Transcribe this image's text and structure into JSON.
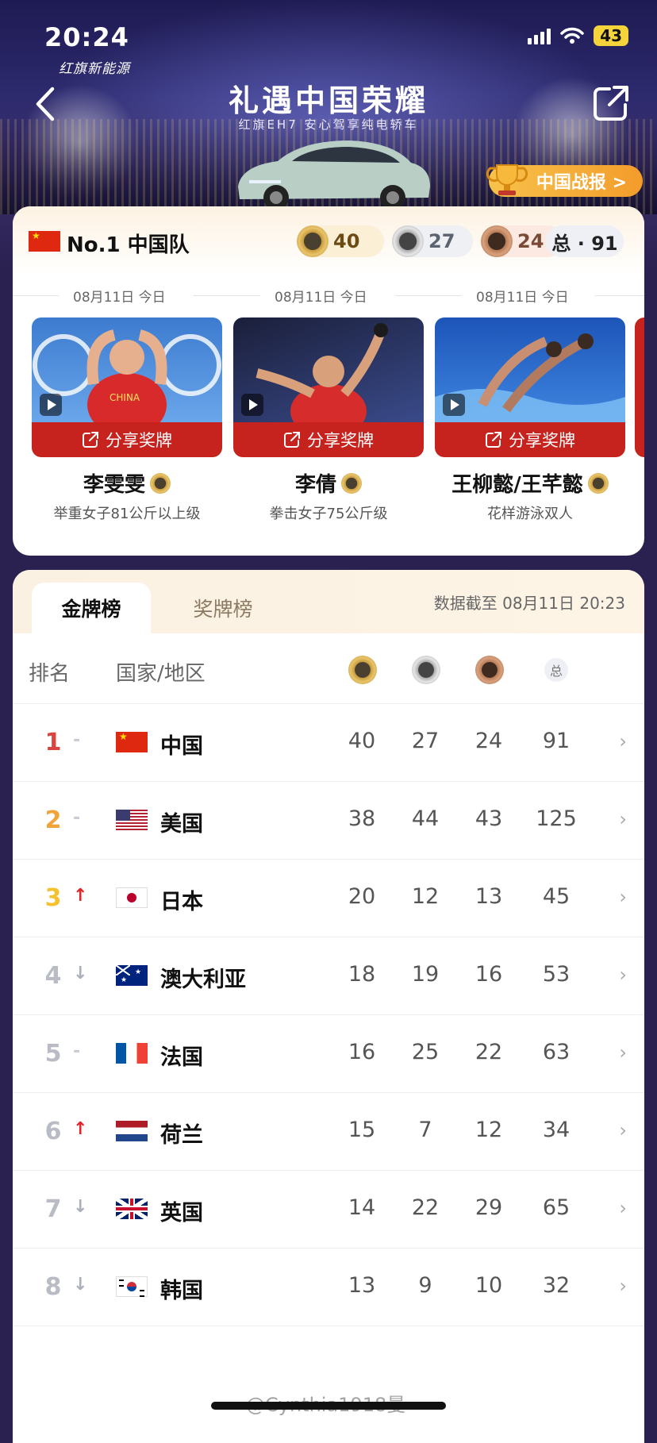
{
  "status_bar": {
    "time": "20:24",
    "battery": "43"
  },
  "hero": {
    "brand": "红旗新能源",
    "title": "礼遇中国荣耀",
    "subtitle": "红旗EH7  安心驾享纯电轿车",
    "report_button": "中国战报 >"
  },
  "team": {
    "name": "No.1 中国队",
    "gold": "40",
    "silver": "27",
    "bronze": "24",
    "total": "总 · 91"
  },
  "share_label": "分享奖牌",
  "athletes": [
    {
      "date": "08月11日 今日",
      "name": "李雯雯",
      "event": "举重女子81公斤以上级"
    },
    {
      "date": "08月11日 今日",
      "name": "李倩",
      "event": "拳击女子75公斤级"
    },
    {
      "date": "08月11日 今日",
      "name": "王柳懿/王芊懿",
      "event": "花样游泳双人"
    }
  ],
  "ranking": {
    "tab_gold": "金牌榜",
    "tab_medal": "奖牌榜",
    "updated": "数据截至 08月11日 20:23",
    "col_rank": "排名",
    "col_country": "国家/地区",
    "col_total": "总",
    "rows": [
      {
        "rank": "1",
        "trend": "-",
        "country": "中国",
        "gold": "40",
        "silver": "27",
        "bronze": "24",
        "total": "91"
      },
      {
        "rank": "2",
        "trend": "-",
        "country": "美国",
        "gold": "38",
        "silver": "44",
        "bronze": "43",
        "total": "125"
      },
      {
        "rank": "3",
        "trend": "↑",
        "country": "日本",
        "gold": "20",
        "silver": "12",
        "bronze": "13",
        "total": "45"
      },
      {
        "rank": "4",
        "trend": "↓",
        "country": "澳大利亚",
        "gold": "18",
        "silver": "19",
        "bronze": "16",
        "total": "53"
      },
      {
        "rank": "5",
        "trend": "-",
        "country": "法国",
        "gold": "16",
        "silver": "25",
        "bronze": "22",
        "total": "63"
      },
      {
        "rank": "6",
        "trend": "↑",
        "country": "荷兰",
        "gold": "15",
        "silver": "7",
        "bronze": "12",
        "total": "34"
      },
      {
        "rank": "7",
        "trend": "↓",
        "country": "英国",
        "gold": "14",
        "silver": "22",
        "bronze": "29",
        "total": "65"
      },
      {
        "rank": "8",
        "trend": "↓",
        "country": "韩国",
        "gold": "13",
        "silver": "9",
        "bronze": "10",
        "total": "32"
      }
    ]
  },
  "watermark": "@Cynthia1918曼",
  "colors": {
    "rank1": "#d9453e",
    "rank2": "#f0a43a",
    "rank3": "#f5c12e",
    "rank_other": "#b9bcc4",
    "up": "#e0242a",
    "down": "#aab0ba"
  }
}
